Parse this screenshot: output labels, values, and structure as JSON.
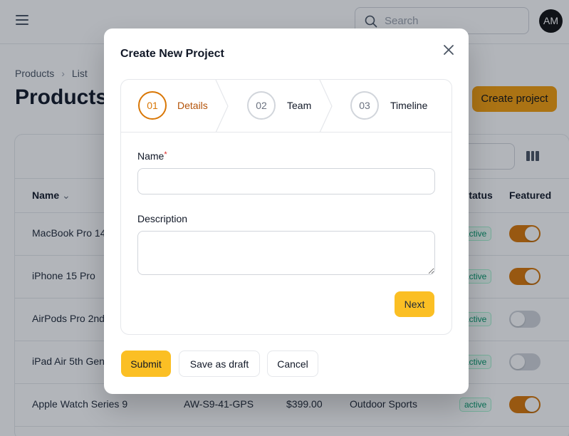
{
  "header": {
    "search_placeholder": "Search",
    "avatar_initials": "AM"
  },
  "breadcrumb": {
    "items": [
      "Products",
      "List"
    ]
  },
  "page": {
    "title": "Products",
    "create_button": "Create project"
  },
  "table": {
    "columns": [
      "Name",
      "Status",
      "Featured"
    ],
    "rows": [
      {
        "name": "MacBook Pro 14",
        "sku": "",
        "price": "",
        "category": "",
        "status": "active",
        "featured": true
      },
      {
        "name": "iPhone 15 Pro",
        "sku": "",
        "price": "",
        "category": "",
        "status": "active",
        "featured": true
      },
      {
        "name": "AirPods Pro 2nd",
        "sku": "",
        "price": "",
        "category": "",
        "status": "active",
        "featured": false
      },
      {
        "name": "iPad Air 5th Gen",
        "sku": "",
        "price": "",
        "category": "",
        "status": "active",
        "featured": false
      },
      {
        "name": "Apple Watch Series 9",
        "sku": "AW-S9-41-GPS",
        "price": "$399.00",
        "category": "Outdoor Sports",
        "status": "active",
        "featured": true
      }
    ]
  },
  "modal": {
    "title": "Create New Project",
    "steps": [
      {
        "number": "01",
        "label": "Details",
        "active": true
      },
      {
        "number": "02",
        "label": "Team",
        "active": false
      },
      {
        "number": "03",
        "label": "Timeline",
        "active": false
      }
    ],
    "fields": {
      "name_label": "Name",
      "name_required_mark": "*",
      "name_value": "",
      "description_label": "Description",
      "description_value": ""
    },
    "next_button": "Next",
    "footer": {
      "submit": "Submit",
      "save_draft": "Save as draft",
      "cancel": "Cancel"
    }
  },
  "colors": {
    "accent": "#fbbf24",
    "active_step": "#d97706",
    "toggle_on": "#d97706"
  }
}
